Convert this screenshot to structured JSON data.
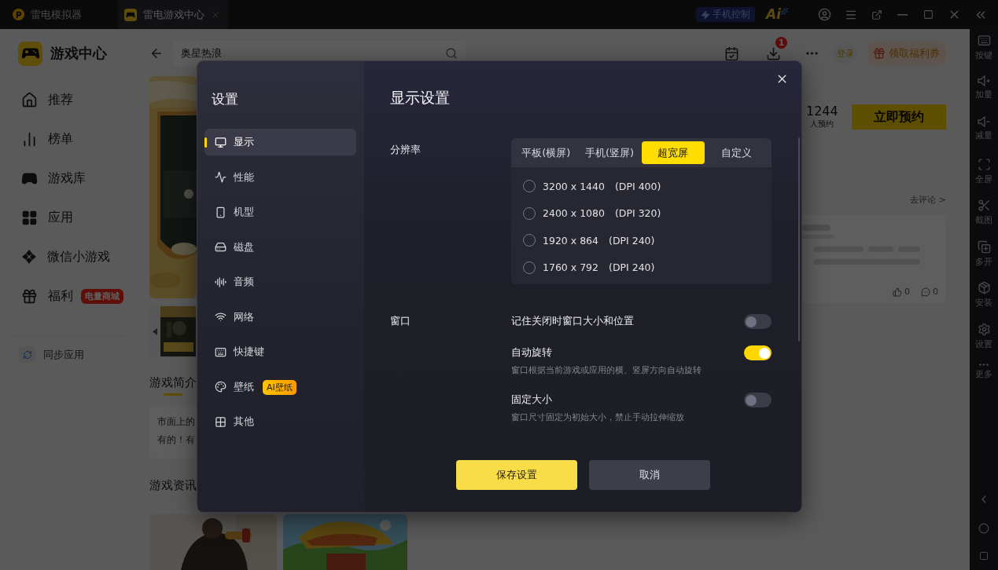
{
  "title_bar": {
    "tabs": [
      {
        "label": "雷电模拟器",
        "selected": false,
        "closable": false
      },
      {
        "label": "雷电游戏中心",
        "selected": true,
        "closable": true
      }
    ],
    "phone_control": "手机控制",
    "ai_button": "Ai"
  },
  "sidebar": {
    "title": "游戏中心",
    "items": [
      {
        "label": "推荐"
      },
      {
        "label": "榜单"
      },
      {
        "label": "游戏库"
      },
      {
        "label": "应用"
      },
      {
        "label": "微信小游戏"
      },
      {
        "label": "福利",
        "badge": "电量商城"
      }
    ],
    "sync": "同步应用"
  },
  "header": {
    "search": {
      "value": "奥星热浪"
    },
    "download_count": "1",
    "login": "登录",
    "coupon": "领取福利券"
  },
  "game": {
    "reservations": "1244",
    "reservations_label": "人预约",
    "reserve_button": "立即预约",
    "intro_title": "游戏简介",
    "intro_lines": [
      "市面上的",
      "有的！有"
    ],
    "news_title": "游戏资讯",
    "comment_link": "去评论 >",
    "likes": "0",
    "replies": "0"
  },
  "toolbar": [
    {
      "label": "按键"
    },
    {
      "label": "加量"
    },
    {
      "label": "减量"
    },
    {
      "label": "全屏"
    },
    {
      "label": "截图"
    },
    {
      "label": "多开"
    },
    {
      "label": "安装"
    },
    {
      "label": "设置"
    },
    {
      "label": "更多"
    }
  ],
  "dialog": {
    "title": "设置",
    "nav": [
      {
        "label": "显示",
        "selected": true
      },
      {
        "label": "性能",
        "selected": false
      },
      {
        "label": "机型",
        "selected": false
      },
      {
        "label": "磁盘",
        "selected": false
      },
      {
        "label": "音频",
        "selected": false
      },
      {
        "label": "网络",
        "selected": false
      },
      {
        "label": "快捷键",
        "selected": false
      },
      {
        "label": "壁纸",
        "selected": false,
        "badge": "AI壁纸"
      },
      {
        "label": "其他",
        "selected": false
      }
    ],
    "heading": "显示设置",
    "resolution": {
      "label": "分辨率",
      "modes": [
        {
          "label": "平板(横屏)",
          "selected": false
        },
        {
          "label": "手机(竖屏)",
          "selected": false
        },
        {
          "label": "超宽屏",
          "selected": true
        },
        {
          "label": "自定义",
          "selected": false
        }
      ],
      "options": [
        {
          "size": "3200 x 1440",
          "dpi": "(DPI 400)",
          "selected": false
        },
        {
          "size": "2400 x 1080",
          "dpi": "(DPI 320)",
          "selected": false
        },
        {
          "size": "1920 x 864",
          "dpi": "(DPI 240)",
          "selected": false
        },
        {
          "size": "1760 x 792",
          "dpi": "(DPI 240)",
          "selected": false
        }
      ]
    },
    "window": {
      "label": "窗口",
      "toggles": [
        {
          "label": "记住关闭时窗口大小和位置",
          "on": false
        },
        {
          "label": "自动旋转",
          "on": true,
          "description": "窗口根据当前游戏或应用的横、竖屏方向自动旋转"
        },
        {
          "label": "固定大小",
          "on": false,
          "description": "窗口尺寸固定为初始大小，禁止手动拉伸缩放"
        }
      ]
    },
    "save": "保存设置",
    "cancel": "取消"
  }
}
